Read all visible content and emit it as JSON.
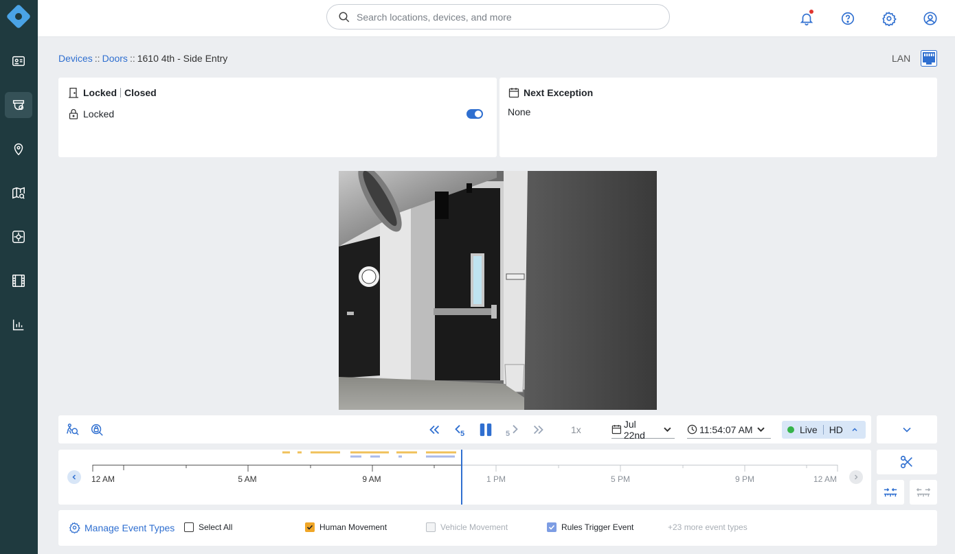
{
  "sidebar": {
    "logo": "app-logo",
    "items": [
      {
        "name": "access-card-icon",
        "active": false
      },
      {
        "name": "camera-icon",
        "active": true
      },
      {
        "name": "location-pin-icon",
        "active": false
      },
      {
        "name": "map-search-icon",
        "active": false
      },
      {
        "name": "sensor-icon",
        "active": false
      },
      {
        "name": "film-icon",
        "active": false
      },
      {
        "name": "analytics-icon",
        "active": false
      }
    ]
  },
  "header": {
    "search_placeholder": "Search locations, devices, and more",
    "icons": [
      "bell-icon",
      "help-icon",
      "gear-icon",
      "user-icon"
    ]
  },
  "breadcrumb": {
    "level1": "Devices",
    "level2": "Doors",
    "current": "1610 4th - Side Entry",
    "separator": "::"
  },
  "connection": {
    "label": "LAN",
    "icon": "ethernet-icon"
  },
  "door_status": {
    "state_lock": "Locked",
    "state_door": "Closed",
    "lock_label": "Locked",
    "lock_toggle_on": true
  },
  "next_exception": {
    "title": "Next Exception",
    "value": "None"
  },
  "playback": {
    "speed": "1x",
    "date": "Jul 22nd",
    "time": "11:54:07 AM",
    "live_label": "Live",
    "quality": "HD",
    "skip_seconds": "5"
  },
  "timeline": {
    "labels": [
      "12 AM",
      "5 AM",
      "9 AM",
      "1 PM",
      "5 PM",
      "9 PM",
      "12 AM"
    ],
    "colors": {
      "human": "#f0c15a",
      "rules": "#a9b9ea",
      "cursor": "#2f6fd0"
    }
  },
  "event_types": {
    "manage_label": "Manage Event Types",
    "select_all": "Select All",
    "human_movement": "Human Movement",
    "vehicle_movement": "Vehicle Movement",
    "rules_trigger": "Rules Trigger Event",
    "more": "+23 more event types"
  },
  "colors": {
    "accent": "#2f6fd0",
    "sidebar": "#1f3a3f",
    "live": "#35b34a"
  }
}
